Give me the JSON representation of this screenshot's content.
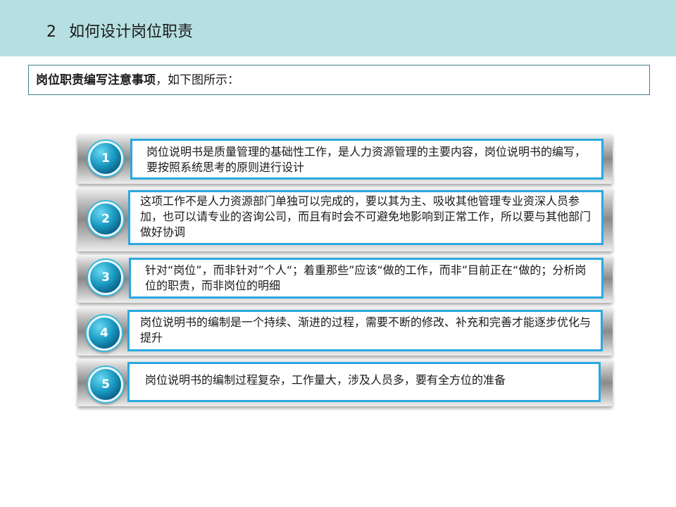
{
  "header": {
    "number": "2",
    "title": "如何设计岗位职责"
  },
  "intro": {
    "bold_text": "岗位职责编写注意事项",
    "normal_text": "，如下图所示："
  },
  "items": [
    {
      "number": "1",
      "text": "岗位说明书是质量管理的基础性工作，是人力资源管理的主要内容，岗位说明书的编写，要按照系统思考的原则进行设计"
    },
    {
      "number": "2",
      "text": "这项工作不是人力资源部门单独可以完成的，要以其为主、吸收其他管理专业资深人员参加，也可以请专业的咨询公司，而且有时会不可避免地影响到正常工作，所以要与其他部门做好协调"
    },
    {
      "number": "3",
      "text": "针对“岗位”，而非针对”个人“；着重那些”应该“做的工作，而非”目前正在“做的；分析岗位的职责，而非岗位的明细"
    },
    {
      "number": "4",
      "text": "岗位说明书的编制是一个持续、渐进的过程，需要不断的修改、补充和完善才能逐步优化与提升"
    },
    {
      "number": "5",
      "text": "岗位说明书的编制过程复杂，工作量大，涉及人员多，要有全方位的准备"
    }
  ],
  "colors": {
    "header_band": "#b6dfe1",
    "accent_blue": "#2aa8df",
    "badge_dark": "#0b5c82"
  }
}
